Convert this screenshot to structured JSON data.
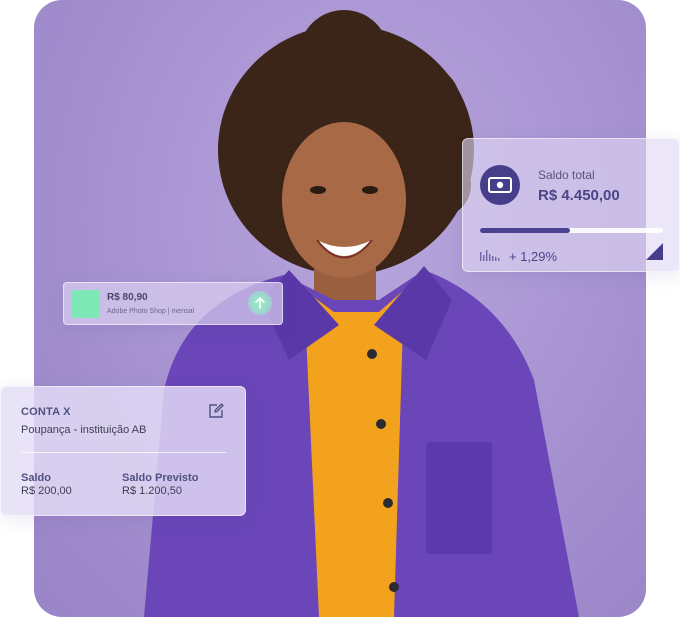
{
  "colors": {
    "background_purple": "#a995d3",
    "jacket_purple": "#6a46b8",
    "brand_dark": "#463e8b",
    "accent_green": "#7be8b6",
    "shirt_yellow": "#f2a21d"
  },
  "hero": {
    "image_subject": "smiling woman with curly hair in purple corduroy jacket"
  },
  "saldo_card": {
    "icon": "money-icon",
    "label": "Saldo total",
    "value": "R$ 4.450,00",
    "progress": 0.49,
    "trend_icon": "sparkline-icon",
    "delta": "+ 1,29%",
    "corner_icon": "triangle-corner-icon"
  },
  "transaction": {
    "amount": "R$ 80,90",
    "description": "Adobe Photo Shop | mensal",
    "icon": "arrow-up-icon"
  },
  "account_card": {
    "title": "CONTA X",
    "subtitle": "Poupança - instituição AB",
    "edit_icon": "edit-icon",
    "saldo_label": "Saldo",
    "saldo_value": "R$ 200,00",
    "previsto_label": "Saldo Previsto",
    "previsto_value": "R$ 1.200,50"
  }
}
